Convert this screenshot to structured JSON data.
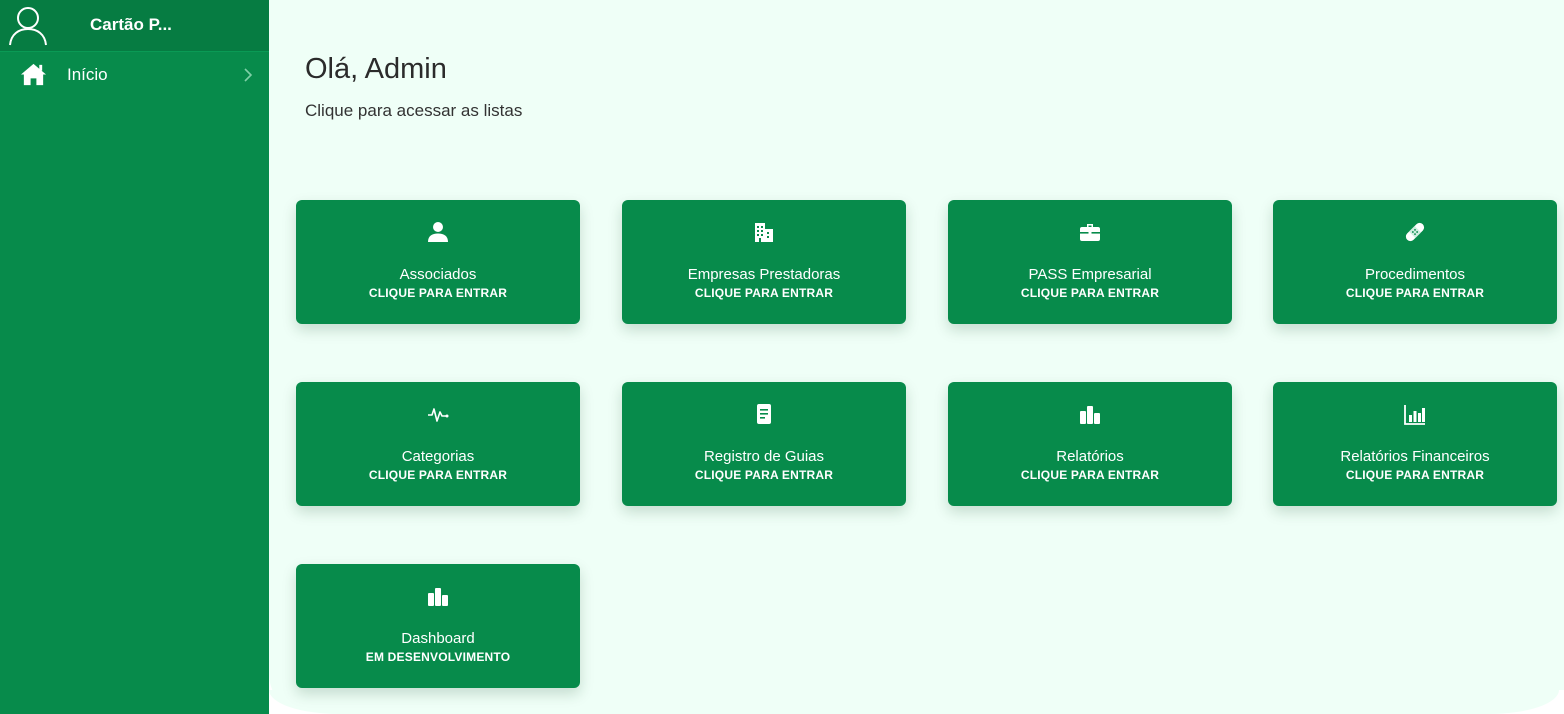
{
  "sidebar": {
    "brand": "Cartão P...",
    "avatar_icon": "user-outline-icon",
    "items": [
      {
        "label": "Início",
        "icon": "home-icon"
      }
    ]
  },
  "main": {
    "greeting": "Olá, Admin",
    "subtitle": "Clique para acessar as listas",
    "cards": [
      {
        "title": "Associados",
        "cta": "CLIQUE PARA ENTRAR",
        "icon": "user-icon"
      },
      {
        "title": "Empresas Prestadoras",
        "cta": "CLIQUE PARA ENTRAR",
        "icon": "building-icon"
      },
      {
        "title": "PASS Empresarial",
        "cta": "CLIQUE PARA ENTRAR",
        "icon": "briefcase-icon"
      },
      {
        "title": "Procedimentos",
        "cta": "CLIQUE PARA ENTRAR",
        "icon": "bandage-icon"
      },
      {
        "title": "Categorias",
        "cta": "CLIQUE PARA ENTRAR",
        "icon": "pulse-icon"
      },
      {
        "title": "Registro de Guias",
        "cta": "CLIQUE PARA ENTRAR",
        "icon": "document-icon"
      },
      {
        "title": "Relatórios",
        "cta": "CLIQUE PARA ENTRAR",
        "icon": "bars-icon"
      },
      {
        "title": "Relatórios Financeiros",
        "cta": "CLIQUE PARA ENTRAR",
        "icon": "chart-icon"
      },
      {
        "title": "Dashboard",
        "cta": "EM DESENVOLVIMENTO",
        "icon": "bars-icon"
      }
    ]
  },
  "colors": {
    "primary": "#078b4b",
    "background": "#effff7",
    "text": "#2b2b2b"
  }
}
